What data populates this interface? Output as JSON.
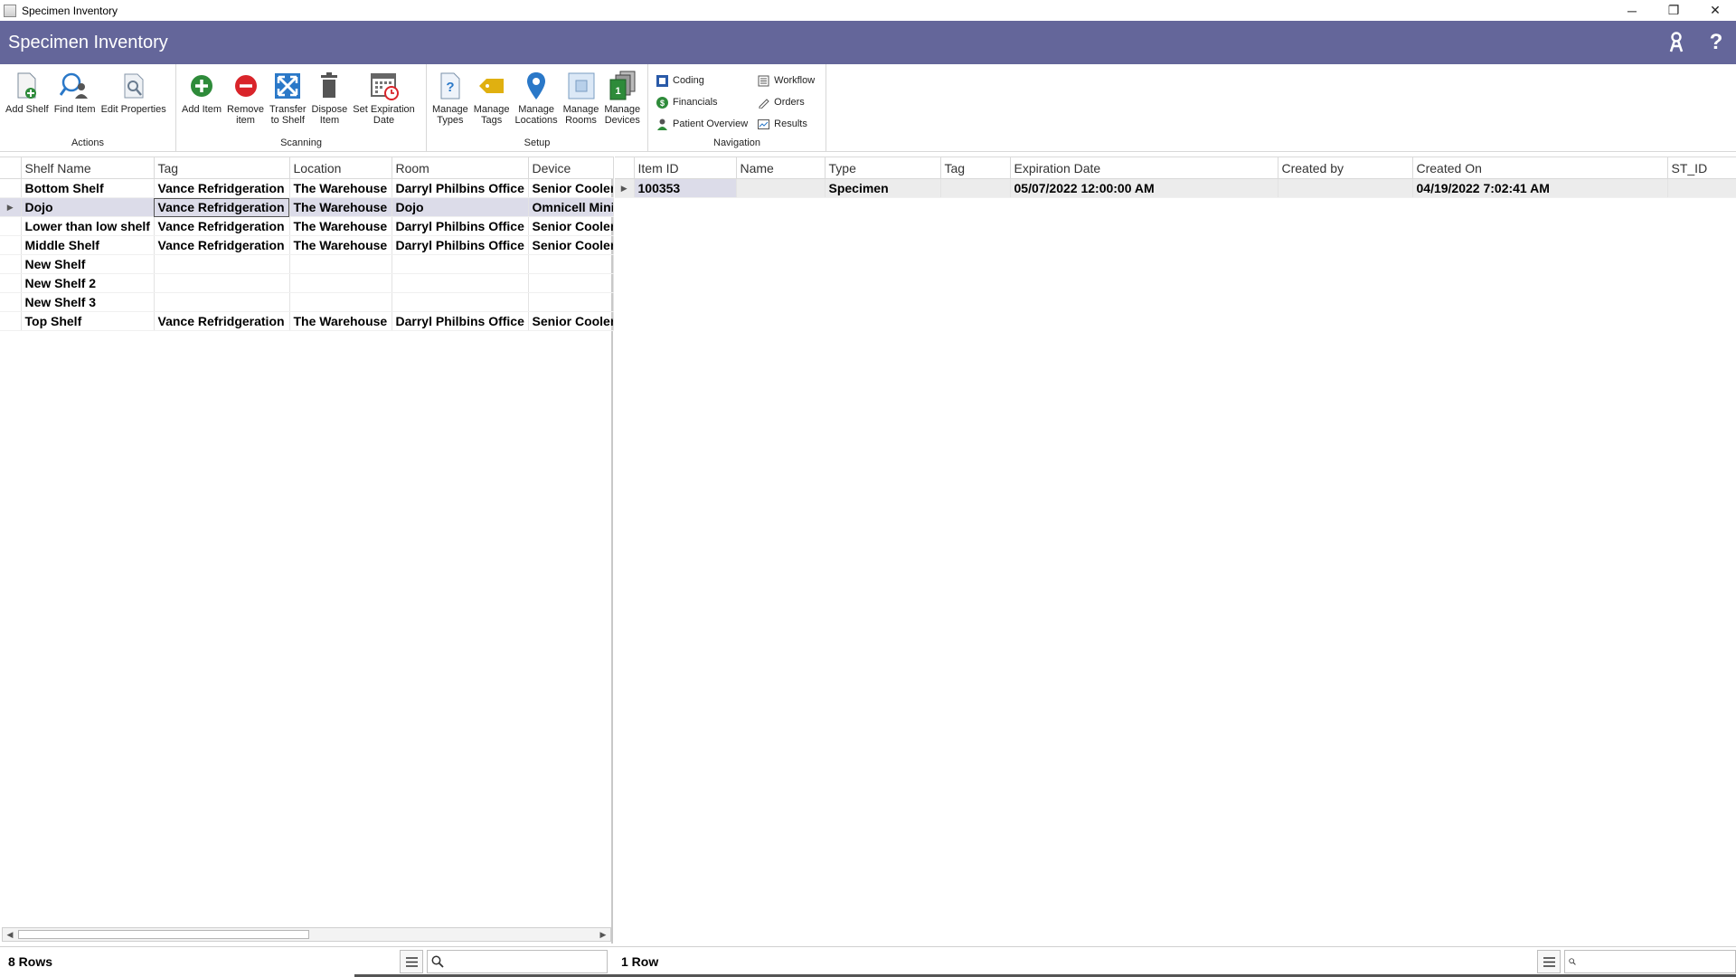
{
  "window": {
    "title": "Specimen Inventory",
    "minimize": "─",
    "restore": "❐",
    "close": "✕"
  },
  "header": {
    "title": "Specimen Inventory",
    "user_icon": "user-badge-icon",
    "help_label": "?"
  },
  "ribbon": {
    "groups": {
      "actions": {
        "label": "Actions",
        "buttons": {
          "add_shelf": "Add Shelf",
          "find_item": "Find Item",
          "edit_properties": "Edit Properties"
        }
      },
      "scanning": {
        "label": "Scanning",
        "buttons": {
          "add_item": "Add Item",
          "remove_item": "Remove\nitem",
          "transfer": "Transfer\nto Shelf",
          "dispose": "Dispose\nItem",
          "set_expiration": "Set Expiration\nDate"
        }
      },
      "setup": {
        "label": "Setup",
        "buttons": {
          "manage_types": "Manage\nTypes",
          "manage_tags": "Manage\nTags",
          "manage_locations": "Manage\nLocations",
          "manage_rooms": "Manage\nRooms",
          "manage_devices": "Manage\nDevices"
        }
      },
      "navigation": {
        "label": "Navigation",
        "links": {
          "coding": "Coding",
          "financials": "Financials",
          "patient_overview": "Patient Overview",
          "workflow": "Workflow",
          "orders": "Orders",
          "results": "Results"
        }
      }
    },
    "colors": {
      "header": "#64669a",
      "add_green": "#2e8b3a",
      "remove_red": "#d9242a",
      "tag_yellow": "#e0b010",
      "accent_blue": "#2a78c8"
    }
  },
  "shelves": {
    "columns": {
      "name": "Shelf Name",
      "tag": "Tag",
      "location": "Location",
      "room": "Room",
      "device": "Device"
    },
    "rows": [
      {
        "name": "Bottom Shelf",
        "tag": "Vance Refridgeration",
        "location": "The Warehouse",
        "room": "Darryl Philbins Office",
        "device": "Senior Cooler"
      },
      {
        "name": "Dojo",
        "tag": "Vance Refridgeration",
        "location": "The Warehouse",
        "room": "Dojo",
        "device": "Omnicell Mini"
      },
      {
        "name": "Lower than low shelf",
        "tag": "Vance Refridgeration",
        "location": "The Warehouse",
        "room": "Darryl Philbins Office",
        "device": "Senior Cooler"
      },
      {
        "name": "Middle Shelf",
        "tag": "Vance Refridgeration",
        "location": "The Warehouse",
        "room": "Darryl Philbins Office",
        "device": "Senior Cooler"
      },
      {
        "name": "New Shelf",
        "tag": "",
        "location": "",
        "room": "",
        "device": ""
      },
      {
        "name": "New Shelf 2",
        "tag": "",
        "location": "",
        "room": "",
        "device": ""
      },
      {
        "name": "New Shelf 3",
        "tag": "",
        "location": "",
        "room": "",
        "device": ""
      },
      {
        "name": "Top Shelf",
        "tag": "Vance Refridgeration",
        "location": "The Warehouse",
        "room": "Darryl Philbins Office",
        "device": "Senior Cooler"
      }
    ],
    "row_count": "8 Rows",
    "search_value": ""
  },
  "items": {
    "columns": {
      "item_id": "Item ID",
      "name": "Name",
      "type": "Type",
      "tag": "Tag",
      "expiration": "Expiration Date",
      "created_by": "Created by",
      "created_on": "Created On",
      "st_id": "ST_ID"
    },
    "rows": [
      {
        "item_id": "100353",
        "name": "",
        "type": "Specimen",
        "tag": "",
        "expiration": "05/07/2022 12:00:00 AM",
        "created_by": "",
        "created_on": "04/19/2022 7:02:41 AM",
        "st_id": ""
      }
    ],
    "row_count": "1 Row",
    "search_value": ""
  }
}
